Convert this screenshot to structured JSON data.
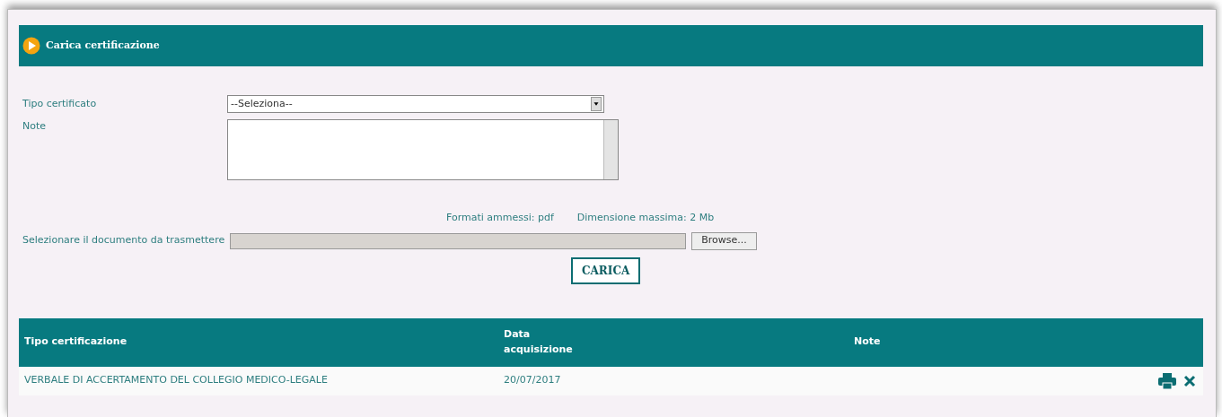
{
  "panel": {
    "title": "Carica certificazione"
  },
  "form": {
    "tipo_label": "Tipo certificato",
    "tipo_value": "--Seleziona--",
    "note_label": "Note",
    "formats": "Formati ammessi: pdf",
    "max_size": "Dimensione massima: 2 Mb",
    "file_label": "Selezionare il documento da trasmettere",
    "browse_button": "Browse...",
    "upload_button": "CARICA"
  },
  "table": {
    "columns": [
      "Tipo certificazione",
      "Data acquisizione",
      "Note"
    ],
    "rows": [
      {
        "cells": [
          "VERBALE DI ACCERTAMENTO DEL COLLEGIO MEDICO-LEGALE",
          "20/07/2017",
          ""
        ]
      }
    ]
  }
}
